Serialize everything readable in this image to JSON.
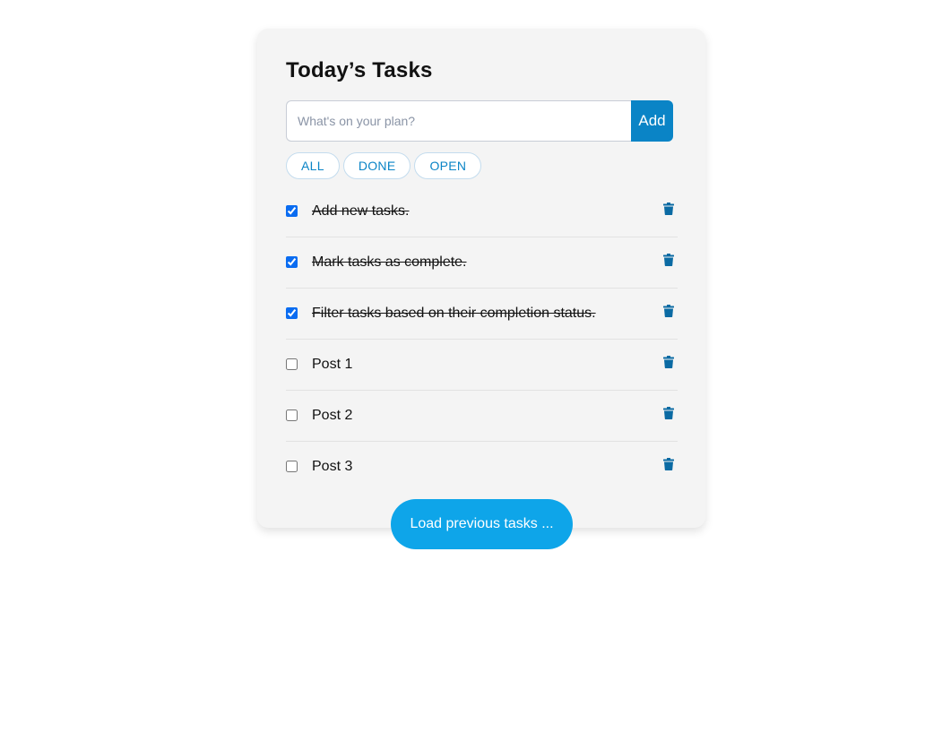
{
  "title": "Today’s Tasks",
  "input": {
    "placeholder": "What's on your plan?",
    "value": ""
  },
  "add_label": "Add",
  "filters": [
    "ALL",
    "DONE",
    "OPEN"
  ],
  "tasks": [
    {
      "label": "Add new tasks.",
      "done": true
    },
    {
      "label": "Mark tasks as complete.",
      "done": true
    },
    {
      "label": "Filter tasks based on their completion status.",
      "done": true
    },
    {
      "label": "Post 1",
      "done": false
    },
    {
      "label": "Post 2",
      "done": false
    },
    {
      "label": "Post 3",
      "done": false
    }
  ],
  "load_more_label": "Load previous tasks ...",
  "icons": {
    "delete": "trash-icon"
  },
  "colors": {
    "accent": "#0a84c6",
    "load_button": "#0ea5e9",
    "card_bg": "#f4f4f4"
  }
}
